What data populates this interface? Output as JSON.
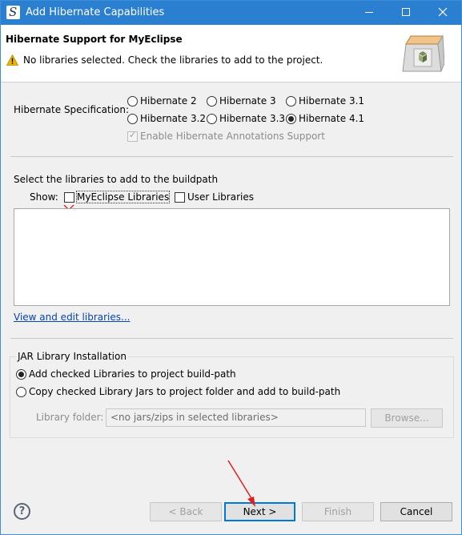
{
  "window": {
    "title": "Add Hibernate Capabilities"
  },
  "header": {
    "title": "Hibernate Support for MyEclipse",
    "message": "No libraries selected. Check the libraries to add to the project."
  },
  "spec": {
    "label": "Hibernate Specification:",
    "options": [
      "Hibernate 2",
      "Hibernate 3",
      "Hibernate 3.1",
      "Hibernate 3.2",
      "Hibernate 3.3",
      "Hibernate 4.1"
    ],
    "selected": "Hibernate 4.1",
    "annotations_label": "Enable Hibernate Annotations Support",
    "annotations_checked": true
  },
  "libraries": {
    "heading": "Select the libraries to add to the buildpath",
    "show_label": "Show:",
    "myeclipse_label": "MyEclipse Libraries",
    "myeclipse_checked": false,
    "user_label": "User Libraries",
    "user_checked": false,
    "view_edit_link": "View and edit libraries..."
  },
  "jar": {
    "group_title": "JAR Library Installation",
    "add_option": "Add checked Libraries to project build-path",
    "copy_option": "Copy checked Library Jars to project folder and add to build-path",
    "selected": "add",
    "folder_label": "Library folder:",
    "folder_value": "<no jars/zips in selected libraries>",
    "browse_label": "Browse..."
  },
  "buttons": {
    "back": "< Back",
    "next": "Next >",
    "finish": "Finish",
    "cancel": "Cancel"
  },
  "icons": {
    "app": "myeclipse-logo-icon",
    "warning": "warning-icon",
    "help": "help-icon",
    "minimize": "minimize-icon",
    "maximize": "maximize-icon",
    "close": "close-icon"
  },
  "colors": {
    "titlebar": "#2b7fd0",
    "link": "#0645ad",
    "annotation_red": "#e02020"
  }
}
